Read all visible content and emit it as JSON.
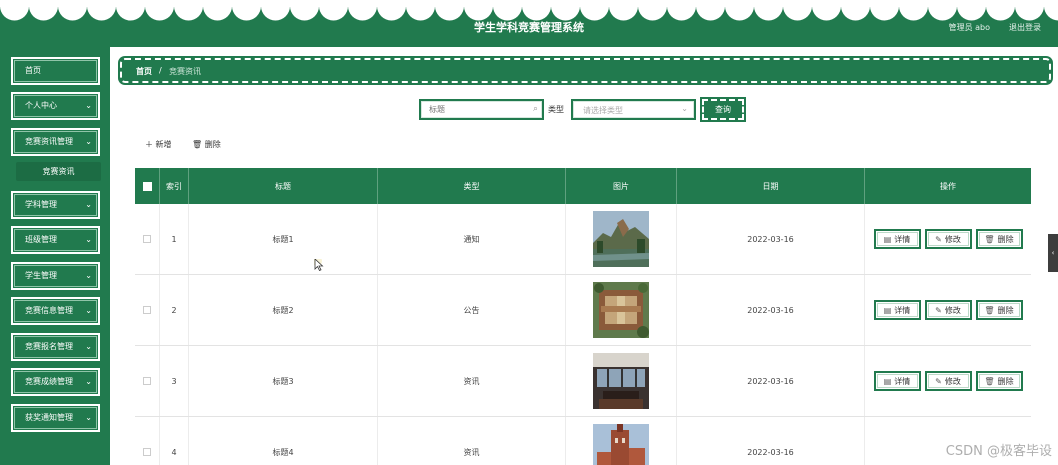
{
  "header": {
    "title": "学生学科竞赛管理系统",
    "user": "管理员 abo",
    "logout": "退出登录"
  },
  "sidebar": {
    "items": [
      {
        "label": "首页",
        "has_children": false
      },
      {
        "label": "个人中心",
        "has_children": true
      },
      {
        "label": "竞赛资讯管理",
        "has_children": true
      },
      {
        "label": "竞赛资讯",
        "is_sub": true
      },
      {
        "label": "学科管理",
        "has_children": true
      },
      {
        "label": "班级管理",
        "has_children": true
      },
      {
        "label": "学生管理",
        "has_children": true
      },
      {
        "label": "竞赛信息管理",
        "has_children": true
      },
      {
        "label": "竞赛报名管理",
        "has_children": true
      },
      {
        "label": "竞赛成绩管理",
        "has_children": true
      },
      {
        "label": "获奖通知管理",
        "has_children": true
      }
    ]
  },
  "breadcrumb": {
    "home": "首页",
    "separator": "/",
    "current": "竞赛资讯"
  },
  "search": {
    "title_placeholder": "标题",
    "type_label": "类型",
    "type_placeholder": "请选择类型",
    "query_label": "查询"
  },
  "actions": {
    "add_label": "新增",
    "delete_label": "删除"
  },
  "table": {
    "columns": [
      "",
      "索引",
      "标题",
      "类型",
      "图片",
      "日期",
      "操作"
    ],
    "rows": [
      {
        "index": "1",
        "title": "标题1",
        "type": "通知",
        "date": "2022-03-16",
        "image": "lake-mountain"
      },
      {
        "index": "2",
        "title": "标题2",
        "type": "公告",
        "date": "2022-03-16",
        "image": "campus-aerial"
      },
      {
        "index": "3",
        "title": "标题3",
        "type": "资讯",
        "date": "2022-03-16",
        "image": "conference-room"
      },
      {
        "index": "4",
        "title": "标题4",
        "type": "资讯",
        "date": "2022-03-16",
        "image": "red-building"
      }
    ],
    "ops": {
      "detail": "详情",
      "edit": "修改",
      "delete": "删除"
    }
  },
  "watermark": "CSDN @极客毕设",
  "colors": {
    "primary": "#217a4e",
    "white": "#ffffff"
  }
}
